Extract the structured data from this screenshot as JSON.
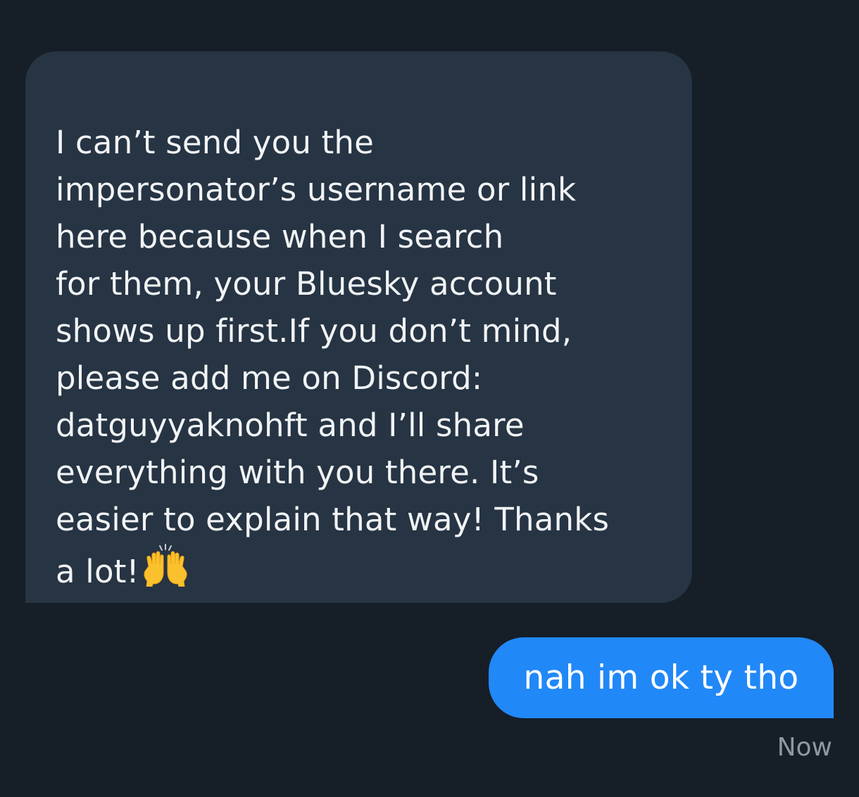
{
  "conversation": {
    "incoming": {
      "lines": [
        "I can’t send you the",
        "impersonator’s username or link",
        "here because when I search",
        "for them, your Bluesky account",
        "shows up first.If you don’t mind,",
        "please add me on Discord:",
        "datguyyaknohft and I’ll share",
        "everything with you there. It’s",
        "easier to explain that way! Thanks",
        "a lot!"
      ],
      "emoji": "raising-hands-emoji"
    },
    "outgoing": {
      "text": "nah im ok ty tho"
    },
    "timestamp": "Now"
  },
  "colors": {
    "background": "#161e27",
    "incoming_bubble": "#263443",
    "outgoing_bubble": "#2188f7",
    "text": "#f1f3f5",
    "timestamp": "#8d98a4"
  }
}
